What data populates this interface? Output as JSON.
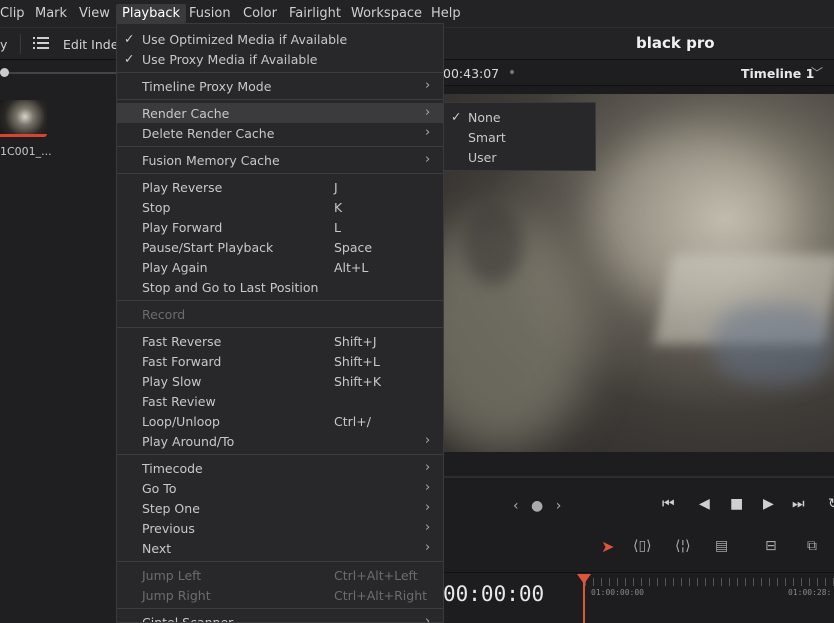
{
  "menubar": {
    "items": [
      "Clip",
      "Mark",
      "View",
      "Playback",
      "Fusion",
      "Color",
      "Fairlight",
      "Workspace",
      "Help"
    ],
    "active": "Playback"
  },
  "toolbar": {
    "cut_label": "y",
    "edit_index": "Edit Index",
    "project_title": "black pro"
  },
  "viewer_header": {
    "timecode": "00:43:07",
    "timeline_name": "Timeline 1"
  },
  "media_pool": {
    "clip_name": "1C001_..."
  },
  "playback_menu": {
    "items": [
      {
        "label": "Use Optimized Media if Available",
        "checked": true
      },
      {
        "label": "Use Proxy Media if Available",
        "checked": true
      },
      {
        "label": "Timeline Proxy Mode",
        "submenu": true
      },
      {
        "label": "Render Cache",
        "submenu": true,
        "highlighted": true
      },
      {
        "label": "Delete Render Cache",
        "submenu": true
      },
      {
        "label": "Fusion Memory Cache",
        "submenu": true
      },
      {
        "label": "Play Reverse",
        "shortcut": "J"
      },
      {
        "label": "Stop",
        "shortcut": "K"
      },
      {
        "label": "Play Forward",
        "shortcut": "L"
      },
      {
        "label": "Pause/Start Playback",
        "shortcut": "Space"
      },
      {
        "label": "Play Again",
        "shortcut": "Alt+L"
      },
      {
        "label": "Stop and Go to Last Position",
        "shortcut": ""
      },
      {
        "label": "Record",
        "disabled": true
      },
      {
        "label": "Fast Reverse",
        "shortcut": "Shift+J"
      },
      {
        "label": "Fast Forward",
        "shortcut": "Shift+L"
      },
      {
        "label": "Play Slow",
        "shortcut": "Shift+K"
      },
      {
        "label": "Fast Review",
        "shortcut": ""
      },
      {
        "label": "Loop/Unloop",
        "shortcut": "Ctrl+/"
      },
      {
        "label": "Play Around/To",
        "submenu": true
      },
      {
        "label": "Timecode",
        "submenu": true
      },
      {
        "label": "Go To",
        "submenu": true
      },
      {
        "label": "Step One",
        "submenu": true
      },
      {
        "label": "Previous",
        "submenu": true
      },
      {
        "label": "Next",
        "submenu": true
      },
      {
        "label": "Jump Left",
        "shortcut": "Ctrl+Alt+Left",
        "disabled": true
      },
      {
        "label": "Jump Right",
        "shortcut": "Ctrl+Alt+Right",
        "disabled": true
      },
      {
        "label": "Cintel Scanner",
        "submenu": true
      }
    ]
  },
  "render_cache_submenu": {
    "items": [
      {
        "label": "None",
        "checked": true
      },
      {
        "label": "Smart"
      },
      {
        "label": "User"
      }
    ]
  },
  "timeline": {
    "big_timecode": "00:00:00",
    "ruler_start": "01:00:00:00",
    "ruler_next": "01:00:28:"
  },
  "colors": {
    "accent_red": "#e0553a",
    "menu_bg": "#28282b",
    "highlight": "#3b3b3e"
  }
}
